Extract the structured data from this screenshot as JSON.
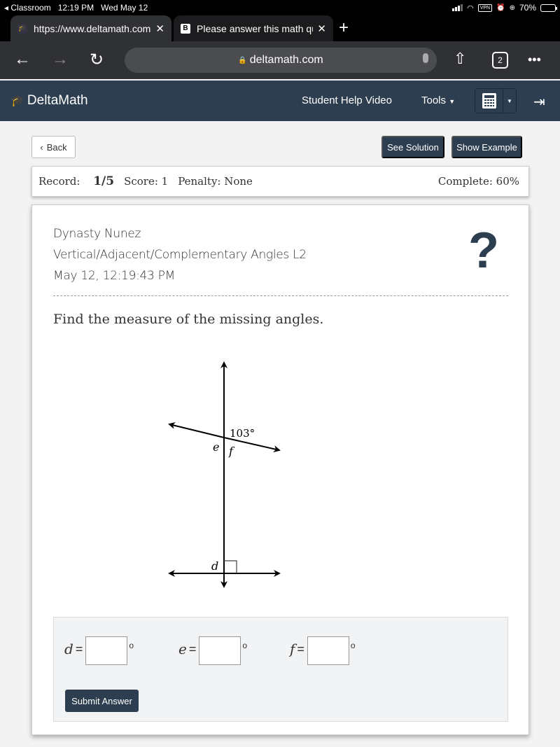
{
  "status_bar": {
    "back_app": "Classroom",
    "time": "12:19 PM",
    "date": "Wed May 12",
    "vpn_label": "VPN",
    "battery_percent": "70%",
    "battery_level": 0.7
  },
  "browser": {
    "tabs": [
      {
        "title": "https://www.deltamath.com",
        "favicon": "deltamath-icon",
        "active": true
      },
      {
        "title": "Please answer this math question",
        "favicon": "B",
        "active": false
      }
    ],
    "new_tab_label": "+",
    "url": "deltamath.com",
    "tab_count": "2",
    "close_glyph": "✕"
  },
  "app_header": {
    "logo_text": "DeltaMath",
    "links": {
      "help_video": "Student Help Video",
      "tools": "Tools"
    }
  },
  "actions": {
    "back": "Back",
    "see_solution": "See Solution",
    "show_example": "Show Example"
  },
  "record_bar": {
    "record_label": "Record:",
    "record_value": "1/5",
    "score": "Score: 1",
    "penalty": "Penalty: None",
    "complete": "Complete: 60%"
  },
  "problem": {
    "student_name": "Dynasty Nunez",
    "assignment": "Vertical/Adjacent/Complementary Angles L2",
    "timestamp": "May 12, 12:19:43 PM",
    "help_glyph": "?",
    "prompt": "Find the measure of the missing angles.",
    "diagram": {
      "given_angle_label": "103°",
      "labels": {
        "e": "e",
        "f": "f",
        "d": "d"
      }
    }
  },
  "answers": {
    "fields": [
      {
        "var": "d",
        "eq": "=",
        "value": "",
        "deg": "o"
      },
      {
        "var": "e",
        "eq": "=",
        "value": "",
        "deg": "o"
      },
      {
        "var": "f",
        "eq": "=",
        "value": "",
        "deg": "o"
      }
    ],
    "submit_label": "Submit Answer"
  }
}
